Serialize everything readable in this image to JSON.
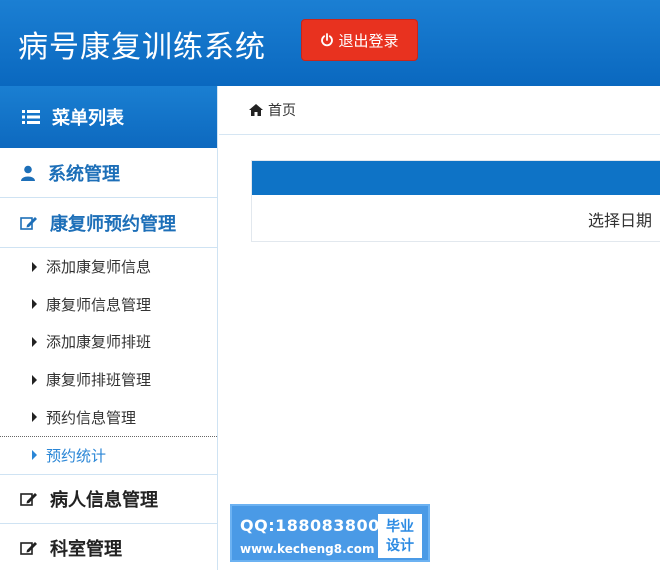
{
  "header": {
    "app_title": "病号康复训练系统",
    "logout_label": "退出登录"
  },
  "sidebar": {
    "menu_title": "菜单列表",
    "sections": [
      {
        "label": "系统管理",
        "icon": "user-icon",
        "color": "#1d6fb8"
      },
      {
        "label": "康复师预约管理",
        "icon": "edit-icon",
        "color": "#1d6fb8"
      }
    ],
    "items": [
      {
        "label": "添加康复师信息"
      },
      {
        "label": "康复师信息管理"
      },
      {
        "label": "添加康复师排班"
      },
      {
        "label": "康复师排班管理"
      },
      {
        "label": "预约信息管理"
      },
      {
        "label": "预约统计",
        "active": true
      }
    ],
    "lower_sections": [
      {
        "label": "病人信息管理",
        "icon": "edit-icon"
      },
      {
        "label": "科室管理",
        "icon": "edit-icon"
      }
    ]
  },
  "breadcrumb": {
    "home_label": "首页"
  },
  "panel": {
    "date_label": "选择日期"
  },
  "watermark": {
    "qq": "QQ:188083800",
    "url": "www.kecheng8.com",
    "tag_line1": "毕业",
    "tag_line2": "设计"
  },
  "colors": {
    "primary": "#0e73c6",
    "logout": "#e8321f",
    "active_link": "#2a86d6"
  }
}
